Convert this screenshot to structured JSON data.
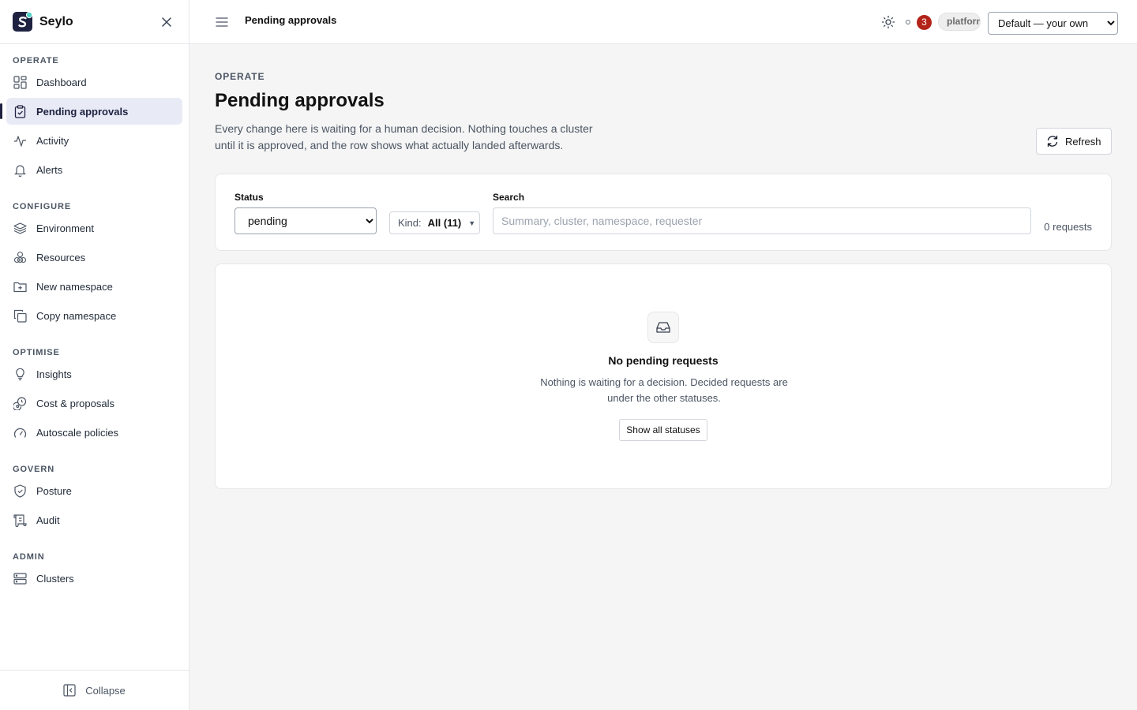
{
  "app": {
    "name": "Seylo",
    "brand_color": "#1e2140",
    "accent_dot_color": "#4fd1c5"
  },
  "sidebar": {
    "sections": [
      {
        "title": "OPERATE",
        "items": [
          {
            "label": "Dashboard",
            "icon": "dashboard-grid-icon",
            "active": false
          },
          {
            "label": "Pending approvals",
            "icon": "clipboard-check-icon",
            "active": true
          },
          {
            "label": "Activity",
            "icon": "activity-pulse-icon",
            "active": false
          },
          {
            "label": "Alerts",
            "icon": "bell-icon",
            "active": false
          }
        ]
      },
      {
        "title": "CONFIGURE",
        "items": [
          {
            "label": "Environment",
            "icon": "layers-icon",
            "active": false
          },
          {
            "label": "Resources",
            "icon": "boxes-icon",
            "active": false
          },
          {
            "label": "New namespace",
            "icon": "folder-plus-icon",
            "active": false
          },
          {
            "label": "Copy namespace",
            "icon": "copy-icon",
            "active": false
          }
        ]
      },
      {
        "title": "OPTIMISE",
        "items": [
          {
            "label": "Insights",
            "icon": "lightbulb-icon",
            "active": false
          },
          {
            "label": "Cost & proposals",
            "icon": "coins-icon",
            "active": false
          },
          {
            "label": "Autoscale policies",
            "icon": "gauge-icon",
            "active": false
          }
        ]
      },
      {
        "title": "GOVERN",
        "items": [
          {
            "label": "Posture",
            "icon": "shield-check-icon",
            "active": false
          },
          {
            "label": "Audit",
            "icon": "scroll-icon",
            "active": false
          }
        ]
      },
      {
        "title": "ADMIN",
        "items": [
          {
            "label": "Clusters",
            "icon": "server-icon",
            "active": false
          }
        ]
      }
    ],
    "collapse_label": "Collapse"
  },
  "topbar": {
    "title": "Pending approvals",
    "notification_count": "3",
    "badge_color": "#b42318",
    "context_chip": "platform",
    "scope_options": [
      "Default — your own"
    ],
    "scope_selected": "Default — your own"
  },
  "page": {
    "eyebrow": "OPERATE",
    "title": "Pending approvals",
    "description": "Every change here is waiting for a human decision. Nothing touches a cluster until it is approved, and the row shows what actually landed afterwards.",
    "refresh_label": "Refresh"
  },
  "filters": {
    "status_label": "Status",
    "status_options": [
      "pending"
    ],
    "status_selected": "pending",
    "kind_label": "Kind:",
    "kind_value": "All (11)",
    "search_label": "Search",
    "search_placeholder": "Summary, cluster, namespace, requester",
    "search_value": "",
    "request_count": "0 requests"
  },
  "empty_state": {
    "icon": "inbox-icon",
    "title": "No pending requests",
    "description": "Nothing is waiting for a decision. Decided requests are under the other statuses.",
    "button_label": "Show all statuses"
  }
}
